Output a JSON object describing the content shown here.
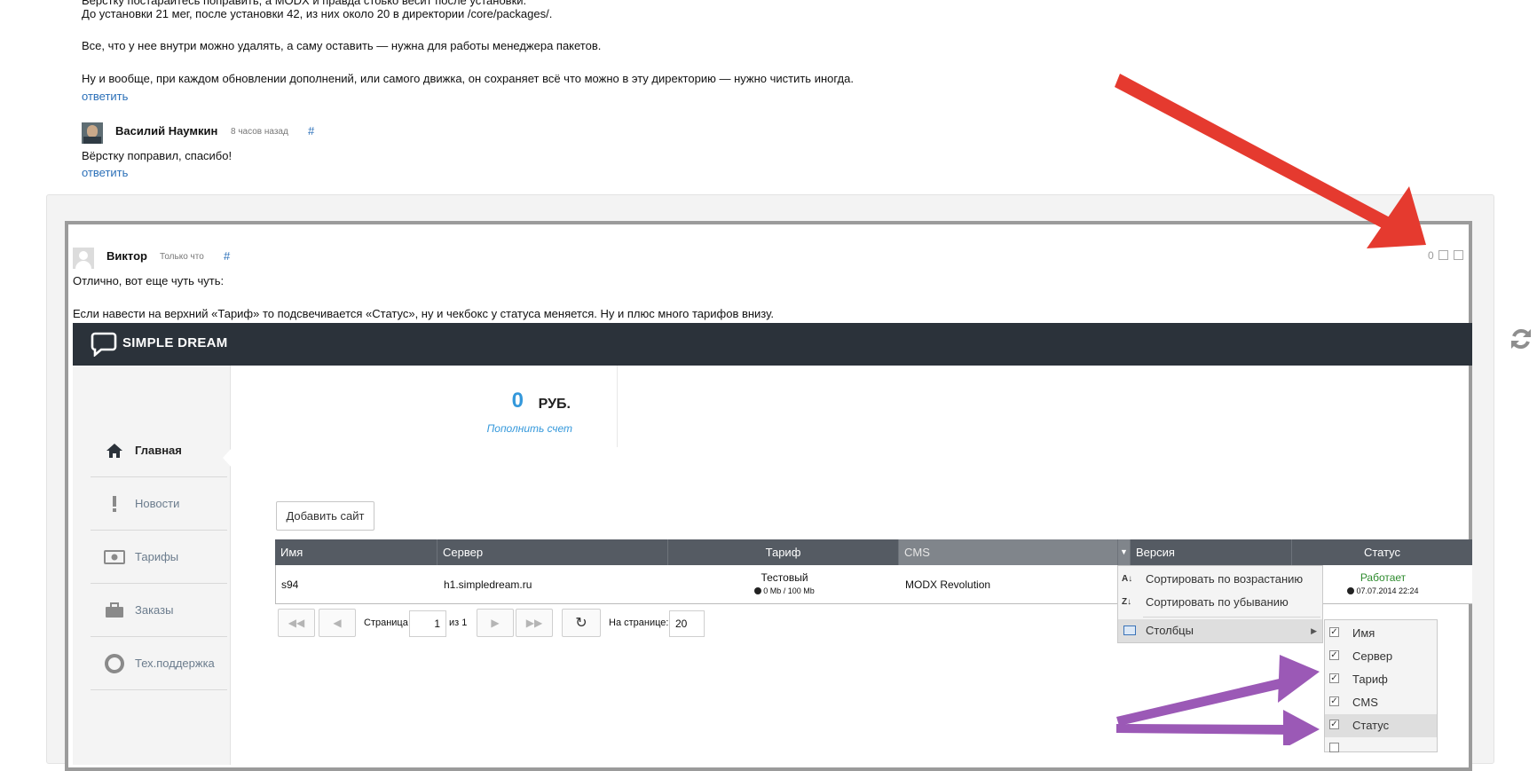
{
  "comments_above": {
    "line1_partial": "Вёрстку постарайтесь поправить, а MODX и правда стоько весит после установки.",
    "line2": "До установки 21 мег, после установки 42, из них около 20 в директории /core/packages/.",
    "line3": "Все, что у нее внутри можно удалять, а саму оставить — нужна для работы менеджера пакетов.",
    "line4": "Ну и вообще, при каждом обновлении дополнений, или самого движка, он сохраняет всё что можно в эту директорию — нужно чистить иногда.",
    "reply_label": "ответить"
  },
  "comment2": {
    "author": "Василий Наумкин",
    "time": "8 часов назад",
    "hash": "#",
    "text": "Вёрстку поправил, спасибо!",
    "reply_label": "ответить"
  },
  "comment3": {
    "author": "Виктор",
    "time": "Только что",
    "hash": "#",
    "rating": "0",
    "text1": "Отлично, вот еще чуть чуть:",
    "text2": "Если навести на верхний «Тариф» то подсвечивается «Статус», ну и чекбокс у статуса меняется. Ну и плюс много тарифов внизу."
  },
  "screenshot": {
    "brand": "SIMPLE DREAM",
    "balance_value": "0",
    "balance_currency": "РУБ.",
    "topup_link": "Пополнить счет",
    "nav": [
      {
        "label": "Главная",
        "icon": "home-icon"
      },
      {
        "label": "Новости",
        "icon": "exclamation-icon"
      },
      {
        "label": "Тарифы",
        "icon": "money-icon"
      },
      {
        "label": "Заказы",
        "icon": "briefcase-icon"
      },
      {
        "label": "Тех.поддержка",
        "icon": "lifebuoy-icon"
      }
    ],
    "add_site_button": "Добавить сайт",
    "columns": [
      "Имя",
      "Сервер",
      "Тариф",
      "CMS",
      "Версия",
      "Статус"
    ],
    "row": {
      "name": "s94",
      "server": "h1.simpledream.ru",
      "tariff": "Тестовый",
      "tariff_usage": "0 Mb / 100 Mb",
      "cms": "MODX Revolution",
      "status": "Работает",
      "status_date": "07.07.2014 22:24"
    },
    "pager": {
      "page_label": "Страница",
      "page_value": "1",
      "of_label": "из 1",
      "per_page_label": "На странице:",
      "per_page_value": "20"
    },
    "context_menu": {
      "sort_asc": "Сортировать по возрастанию",
      "sort_desc": "Сортировать по убыванию",
      "columns": "Столбцы"
    },
    "columns_menu": [
      "Имя",
      "Сервер",
      "Тариф",
      "CMS",
      "Статус"
    ]
  },
  "colors": {
    "red_arrow": "#e53a2f",
    "purple_arrow": "#9b59b6",
    "header_dark": "#2b323a",
    "link_blue": "#2a6fb8",
    "status_green": "#2e8b2e"
  }
}
